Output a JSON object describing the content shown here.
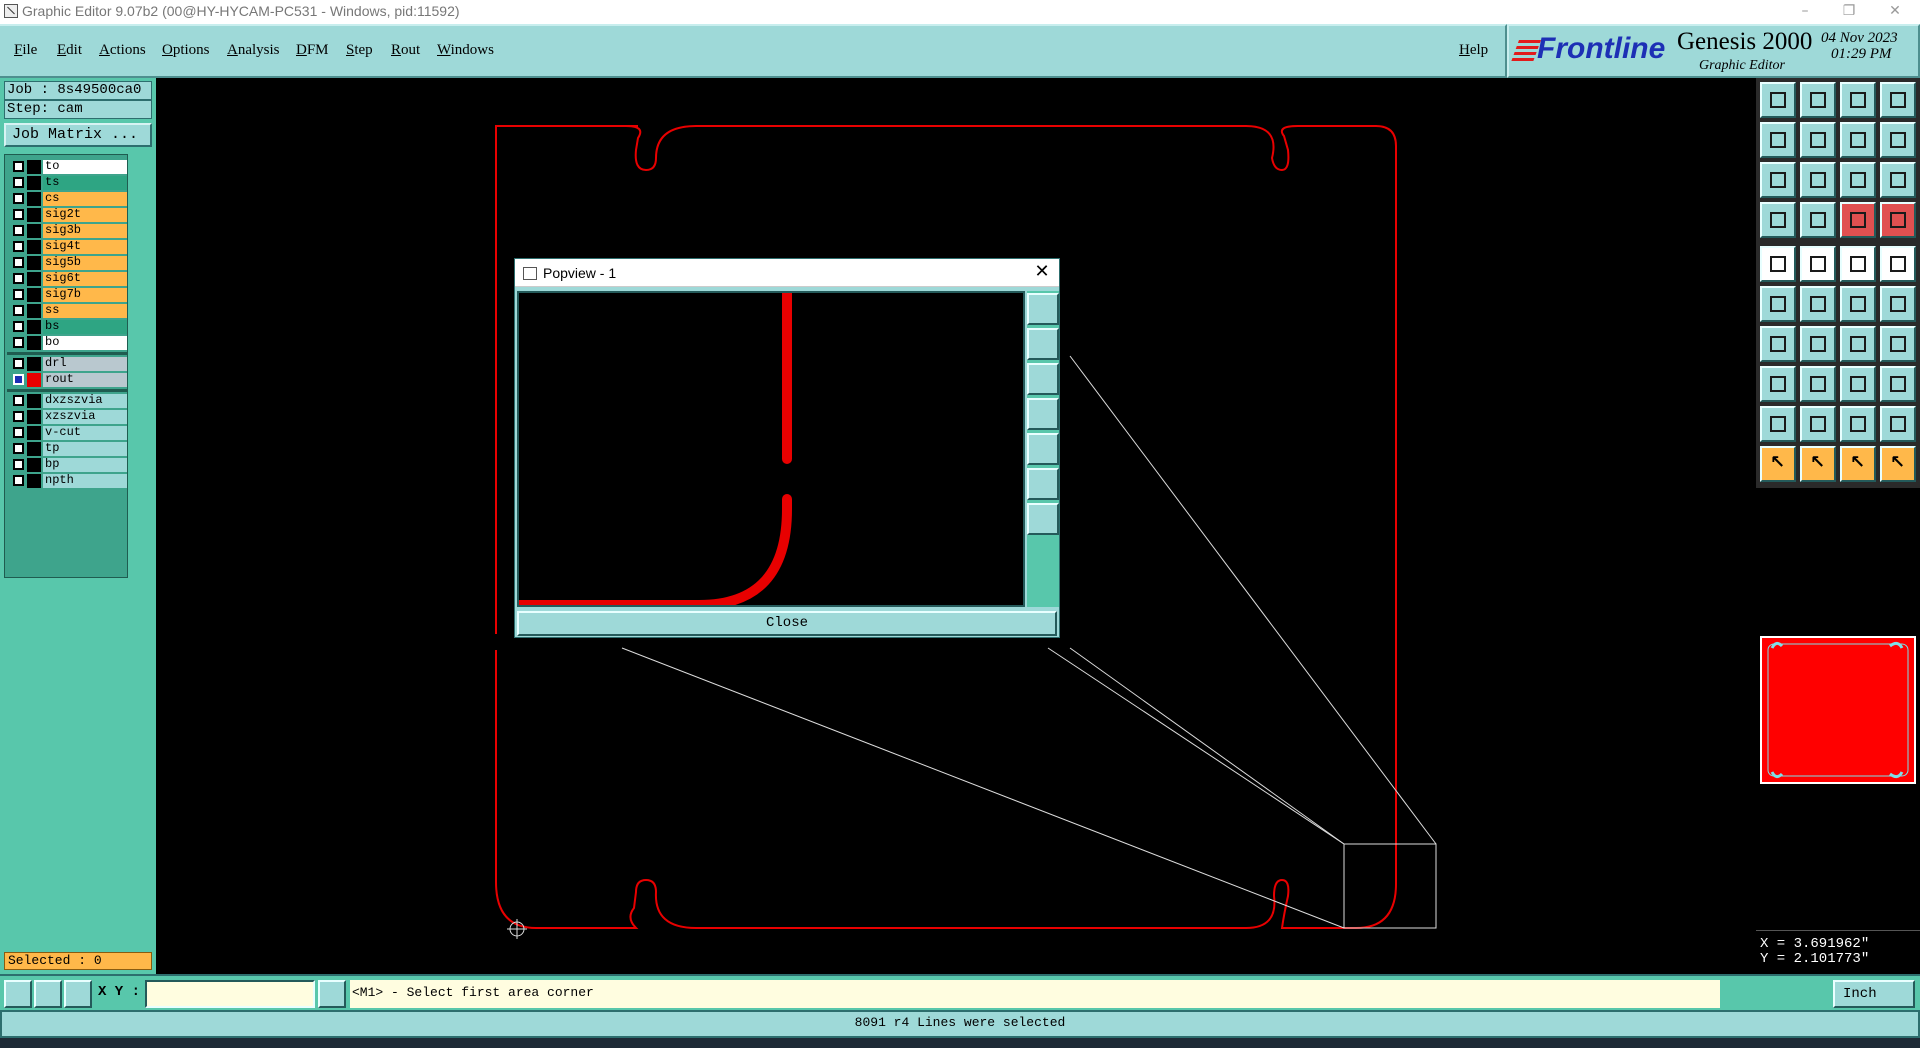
{
  "window": {
    "title": "Graphic Editor 9.07b2 (00@HY-HYCAM-PC531 - Windows, pid:11592)",
    "controls": [
      "–",
      "❐",
      "✕"
    ]
  },
  "menubar": {
    "items": [
      "File",
      "Edit",
      "Actions",
      "Options",
      "Analysis",
      "DFM",
      "Step",
      "Rout",
      "Windows"
    ],
    "help": "Help"
  },
  "brand": {
    "logo": "Frontline",
    "product": "Genesis 2000",
    "subtitle": "Graphic Editor",
    "date": "04 Nov 2023",
    "time": "01:29 PM"
  },
  "leftpanel": {
    "job": "Job : 8s49500ca0",
    "step": "Step: cam",
    "job_matrix": "Job Matrix ...",
    "selected": "Selected : 0"
  },
  "layers": [
    {
      "name": "to",
      "bg": "#ffffff"
    },
    {
      "name": "ts",
      "bg": "#2ea583"
    },
    {
      "name": "cs",
      "bg": "#ffb84a"
    },
    {
      "name": "sig2t",
      "bg": "#ffb84a"
    },
    {
      "name": "sig3b",
      "bg": "#ffb84a"
    },
    {
      "name": "sig4t",
      "bg": "#ffb84a"
    },
    {
      "name": "sig5b",
      "bg": "#ffb84a"
    },
    {
      "name": "sig6t",
      "bg": "#ffb84a"
    },
    {
      "name": "sig7b",
      "bg": "#ffb84a"
    },
    {
      "name": "ss",
      "bg": "#ffb84a"
    },
    {
      "name": "bs",
      "bg": "#2ea583"
    },
    {
      "name": "bo",
      "bg": "#ffffff"
    },
    {
      "name": "drl",
      "bg": "#b9c8cf"
    },
    {
      "name": "rout",
      "bg": "#b9c8cf",
      "active": true
    },
    {
      "name": "dxzszvia",
      "bg": "#9ed9d8"
    },
    {
      "name": "xzszvia",
      "bg": "#9ed9d8"
    },
    {
      "name": "v-cut",
      "bg": "#9ed9d8"
    },
    {
      "name": "tp",
      "bg": "#9ed9d8"
    },
    {
      "name": "bp",
      "bg": "#9ed9d8"
    },
    {
      "name": "npth",
      "bg": "#9ed9d8"
    }
  ],
  "popview": {
    "title": "Popview - 1",
    "close": "Close"
  },
  "coords": {
    "x": "X = 3.691962\"",
    "y": "Y = 2.101773\""
  },
  "bottombar": {
    "xy_label": "X Y :",
    "xy_value": "",
    "prompt": "<M1> - Select first area corner",
    "unit": "Inch"
  },
  "status": "8091 r4 Lines were selected",
  "colors": {
    "panel": "#9ed9d8",
    "panel_dark": "#58c7ab",
    "rout_line": "#e80000",
    "signal_layer": "#ffb84a",
    "mask_layer": "#2ea583"
  }
}
